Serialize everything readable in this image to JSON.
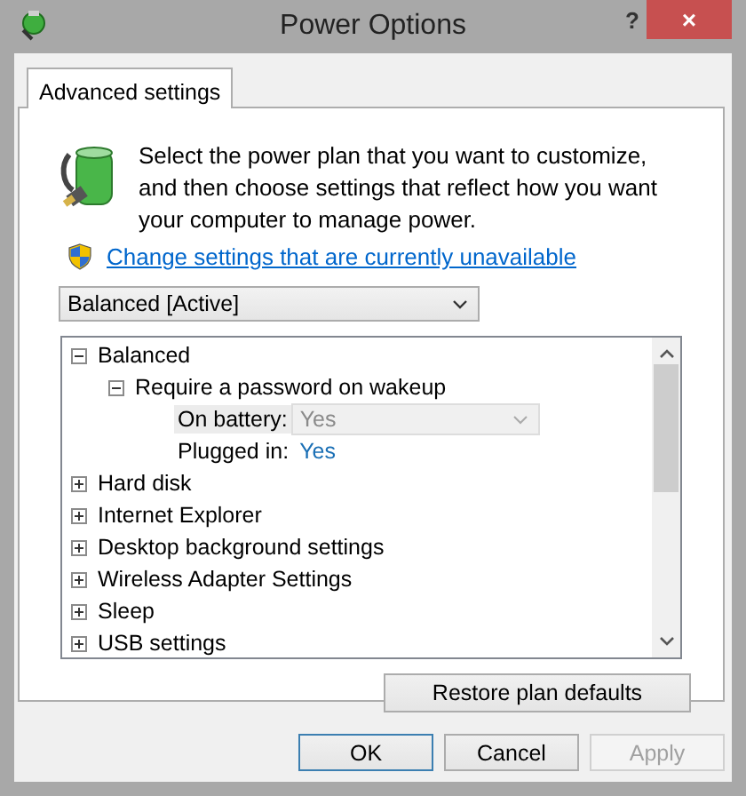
{
  "window": {
    "title": "Power Options",
    "help": "?",
    "close": "×"
  },
  "tabs": [
    {
      "label": "Advanced settings",
      "selected": true
    }
  ],
  "intro": {
    "text": "Select the power plan that you want to customize, and then choose settings that reflect how you want your computer to manage power.",
    "link": "Change settings that are currently unavailable"
  },
  "plan_dropdown": {
    "value": "Balanced [Active]"
  },
  "tree": [
    {
      "label": "Balanced",
      "expanded": true,
      "children": [
        {
          "label": "Require a password on wakeup",
          "expanded": true,
          "settings": [
            {
              "kind": "dropdown",
              "label": "On battery:",
              "value": "Yes",
              "disabled": true
            },
            {
              "kind": "link",
              "label": "Plugged in:",
              "value": "Yes",
              "disabled": false
            }
          ]
        }
      ]
    },
    {
      "label": "Hard disk",
      "expanded": false
    },
    {
      "label": "Internet Explorer",
      "expanded": false
    },
    {
      "label": "Desktop background settings",
      "expanded": false
    },
    {
      "label": "Wireless Adapter Settings",
      "expanded": false
    },
    {
      "label": "Sleep",
      "expanded": false
    },
    {
      "label": "USB settings",
      "expanded": false
    }
  ],
  "restore_button": "Restore plan defaults",
  "buttons": [
    {
      "label": "OK",
      "disabled": false,
      "default": true
    },
    {
      "label": "Cancel",
      "disabled": false,
      "default": false
    },
    {
      "label": "Apply",
      "disabled": true,
      "default": false
    }
  ]
}
